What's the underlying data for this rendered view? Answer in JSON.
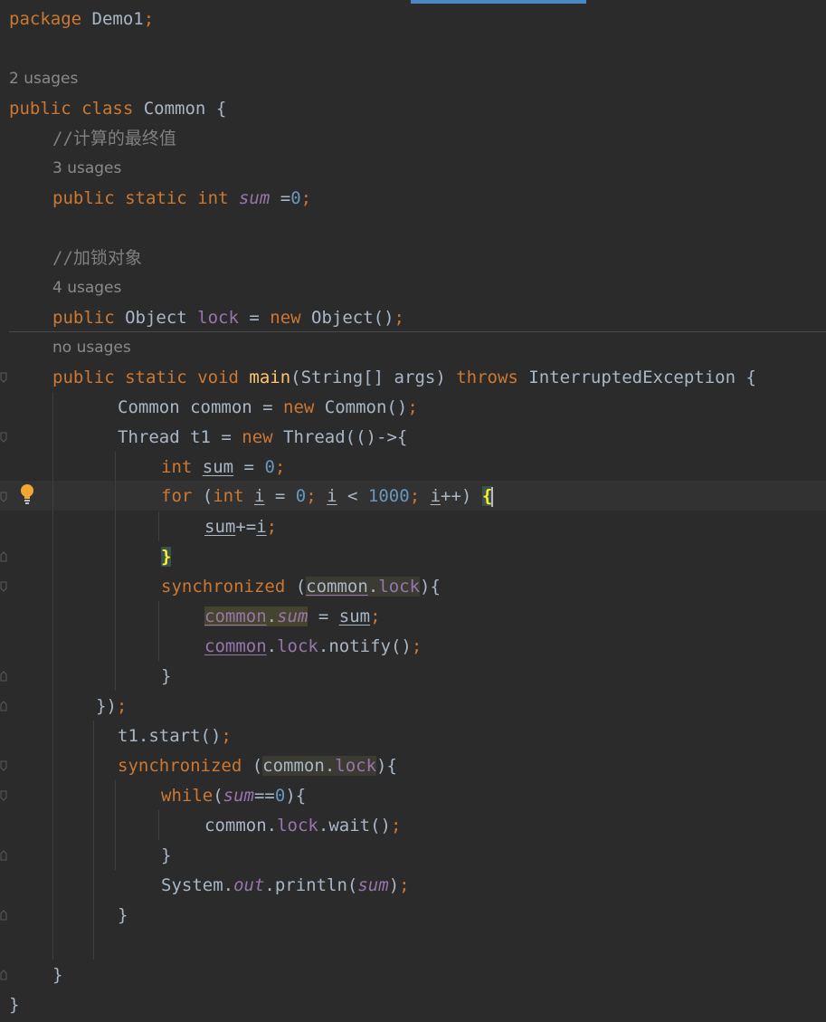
{
  "colors": {
    "background": "#2b2b2b",
    "keyword": "#cc7832",
    "default": "#a9b7c6",
    "number": "#6897bb",
    "comment": "#808080",
    "field": "#9876aa",
    "method": "#ffc66d",
    "hint": "#8a8a8a",
    "tab_accent": "#4a88c7",
    "gutter_icon": "intention-bulb-icon"
  },
  "hints": {
    "class_usages": "2 usages",
    "sum_usages": "3 usages",
    "lock_usages": "4 usages",
    "main_usages": "no usages"
  },
  "code": {
    "l1_kw": "package",
    "l1_rest": " Demo1",
    "semi": ";",
    "public": "public",
    "class": "class",
    "static": "static",
    "int": "int",
    "void": "void",
    "new": "new",
    "throws": "throws",
    "for": "for",
    "while": "while",
    "synchronized": "synchronized",
    "class_name": " Common ",
    "open_brace": "{",
    "close_brace": "}",
    "comment1": "//计算的最终值",
    "comment2": "//加锁对象",
    "sum": "sum",
    "sum_assign": " =",
    "zero": "0",
    "object_type": " Object ",
    "lock": "lock",
    "lock_assign": " = ",
    "object_ctor": " Object()",
    "main": "main",
    "main_params": "(String[] args) ",
    "exception": " InterruptedException {",
    "common_decl": "Common common = ",
    "common_ctor": " Common()",
    "thread_decl": "Thread t1 = ",
    "thread_ctor": " Thread(()->{",
    "i": "i",
    "eq": " = ",
    "for_open": " (",
    "lt": " < ",
    "thousand": "1000",
    "incr": "++) ",
    "pluseq": "+=",
    "sync_open": " (",
    "common": "common",
    "dot": ".",
    "sync_close": "){",
    "notify": "notify()",
    "close_lambda": "})",
    "t1_start": "t1.start()",
    "while_open": "(",
    "eqeq": "==",
    "while_close": "){",
    "wait": "wait()",
    "system": "System.",
    "out": "out",
    "println": ".println(",
    "close_paren": ")"
  }
}
